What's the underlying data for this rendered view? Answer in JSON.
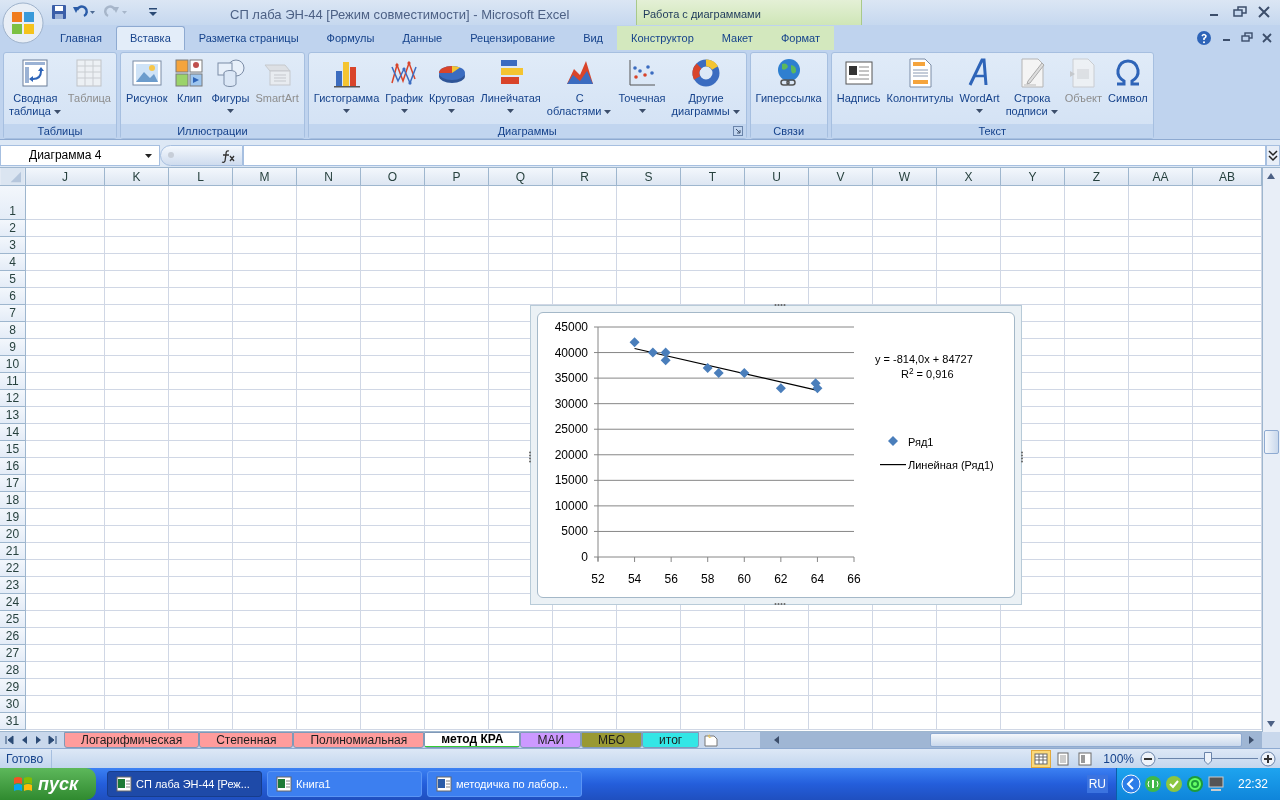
{
  "window": {
    "title": "СП лаба ЭН-44  [Режим совместимости] - Microsoft Excel",
    "context_group": "Работа с диаграммами"
  },
  "ribbon_tabs": [
    {
      "label": "Главная",
      "selected": false,
      "kind": "normal"
    },
    {
      "label": "Вставка",
      "selected": true,
      "kind": "normal"
    },
    {
      "label": "Разметка страницы",
      "selected": false,
      "kind": "normal"
    },
    {
      "label": "Формулы",
      "selected": false,
      "kind": "normal"
    },
    {
      "label": "Данные",
      "selected": false,
      "kind": "normal"
    },
    {
      "label": "Рецензирование",
      "selected": false,
      "kind": "normal"
    },
    {
      "label": "Вид",
      "selected": false,
      "kind": "normal"
    },
    {
      "label": "Конструктор",
      "selected": false,
      "kind": "contextual"
    },
    {
      "label": "Макет",
      "selected": false,
      "kind": "contextual"
    },
    {
      "label": "Формат",
      "selected": false,
      "kind": "contextual"
    }
  ],
  "ribbon_groups": [
    {
      "label": "Таблицы",
      "launcher": false,
      "buttons": [
        {
          "lines": [
            "Сводная",
            "таблица"
          ],
          "dropdown": true,
          "disabled": false
        },
        {
          "lines": [
            "Таблица"
          ],
          "dropdown": false,
          "disabled": true
        }
      ]
    },
    {
      "label": "Иллюстрации",
      "launcher": false,
      "buttons": [
        {
          "lines": [
            "Рисунок"
          ],
          "dropdown": false,
          "disabled": false
        },
        {
          "lines": [
            "Клип"
          ],
          "dropdown": false,
          "disabled": false
        },
        {
          "lines": [
            "Фигуры"
          ],
          "dropdown": true,
          "disabled": false
        },
        {
          "lines": [
            "SmartArt"
          ],
          "dropdown": false,
          "disabled": true
        }
      ]
    },
    {
      "label": "Диаграммы",
      "launcher": true,
      "buttons": [
        {
          "lines": [
            "Гистограмма"
          ],
          "dropdown": true,
          "disabled": false
        },
        {
          "lines": [
            "График"
          ],
          "dropdown": true,
          "disabled": false
        },
        {
          "lines": [
            "Круговая"
          ],
          "dropdown": true,
          "disabled": false
        },
        {
          "lines": [
            "Линейчатая"
          ],
          "dropdown": true,
          "disabled": false
        },
        {
          "lines": [
            "С",
            "областями"
          ],
          "dropdown": true,
          "disabled": false
        },
        {
          "lines": [
            "Точечная"
          ],
          "dropdown": true,
          "disabled": false
        },
        {
          "lines": [
            "Другие",
            "диаграммы"
          ],
          "dropdown": true,
          "disabled": false
        }
      ]
    },
    {
      "label": "Связи",
      "launcher": false,
      "buttons": [
        {
          "lines": [
            "Гиперссылка"
          ],
          "dropdown": false,
          "disabled": false
        }
      ]
    },
    {
      "label": "Текст",
      "launcher": false,
      "buttons": [
        {
          "lines": [
            "Надпись"
          ],
          "dropdown": false,
          "disabled": false
        },
        {
          "lines": [
            "Колонтитулы"
          ],
          "dropdown": false,
          "disabled": false
        },
        {
          "lines": [
            "WordArt"
          ],
          "dropdown": true,
          "disabled": false
        },
        {
          "lines": [
            "Строка",
            "подписи"
          ],
          "dropdown": true,
          "disabled": false
        },
        {
          "lines": [
            "Объект"
          ],
          "dropdown": false,
          "disabled": true
        },
        {
          "lines": [
            "Символ"
          ],
          "dropdown": false,
          "disabled": false
        }
      ]
    }
  ],
  "name_box": "Диаграмма 4",
  "columns": [
    "J",
    "K",
    "L",
    "M",
    "N",
    "O",
    "P",
    "Q",
    "R",
    "S",
    "T",
    "U",
    "V",
    "W",
    "X",
    "Y",
    "Z",
    "AA",
    "AB"
  ],
  "rows": [
    "1",
    "2",
    "3",
    "4",
    "5",
    "6",
    "7",
    "8",
    "9",
    "10",
    "11",
    "12",
    "13",
    "14",
    "15",
    "16",
    "17",
    "18",
    "19",
    "20",
    "21",
    "22",
    "23",
    "24",
    "25",
    "26",
    "27",
    "28",
    "29",
    "30",
    "31"
  ],
  "chart": {
    "chart_data": {
      "type": "scatter",
      "xlim": [
        52,
        66
      ],
      "ylim": [
        0,
        45000
      ],
      "xticks": [
        52,
        54,
        56,
        58,
        60,
        62,
        64,
        66
      ],
      "yticks": [
        0,
        5000,
        10000,
        15000,
        20000,
        25000,
        30000,
        35000,
        40000,
        45000
      ],
      "x": [
        54,
        55,
        55.7,
        55.7,
        58,
        58.6,
        60,
        62,
        63.9,
        64
      ],
      "grid": true,
      "legend": true,
      "series": [
        {
          "name": "Ряд1",
          "color": "#4a7ebb",
          "values": [
            42000,
            40000,
            40000,
            38500,
            37000,
            36000,
            36000,
            33000,
            34000,
            33000
          ]
        },
        {
          "name": "Линейная (Ряд1)",
          "color": "#000000",
          "type": "line",
          "values": [
            40800,
            null,
            null,
            null,
            null,
            null,
            null,
            null,
            null,
            32600
          ]
        }
      ]
    },
    "equation": "y = -814,0x + 84727",
    "r_squared": "R$^{2}$ = 0,916"
  },
  "sheet_tabs": [
    {
      "label": "Логарифмическая",
      "color": "#ff9c9c",
      "selected": false
    },
    {
      "label": "Степенная",
      "color": "#ff9c9c",
      "selected": false
    },
    {
      "label": "Полиномиальная",
      "color": "#ff9c9c",
      "selected": false
    },
    {
      "label": "метод КРА",
      "color": "#33cc33",
      "selected": true
    },
    {
      "label": "МАИ",
      "color": "#cc99ff",
      "selected": false
    },
    {
      "label": "МБО",
      "color": "#999933",
      "selected": false
    },
    {
      "label": "итог",
      "color": "#33e6e6",
      "selected": false
    }
  ],
  "status": {
    "text": "Готово",
    "views": [
      {
        "selected": true
      },
      {
        "selected": false
      },
      {
        "selected": false
      }
    ],
    "zoom": "100%",
    "level": 0.5
  },
  "taskbar": {
    "start": "пуск",
    "tasks": [
      {
        "label": "СП лаба ЭН-44  [Реж...",
        "selected": true,
        "kind": "excel"
      },
      {
        "label": "Книга1",
        "selected": false,
        "kind": "excel"
      },
      {
        "label": "методичка по лабор...",
        "selected": false,
        "kind": "word"
      }
    ],
    "language": "RU",
    "clock": "22:32"
  }
}
